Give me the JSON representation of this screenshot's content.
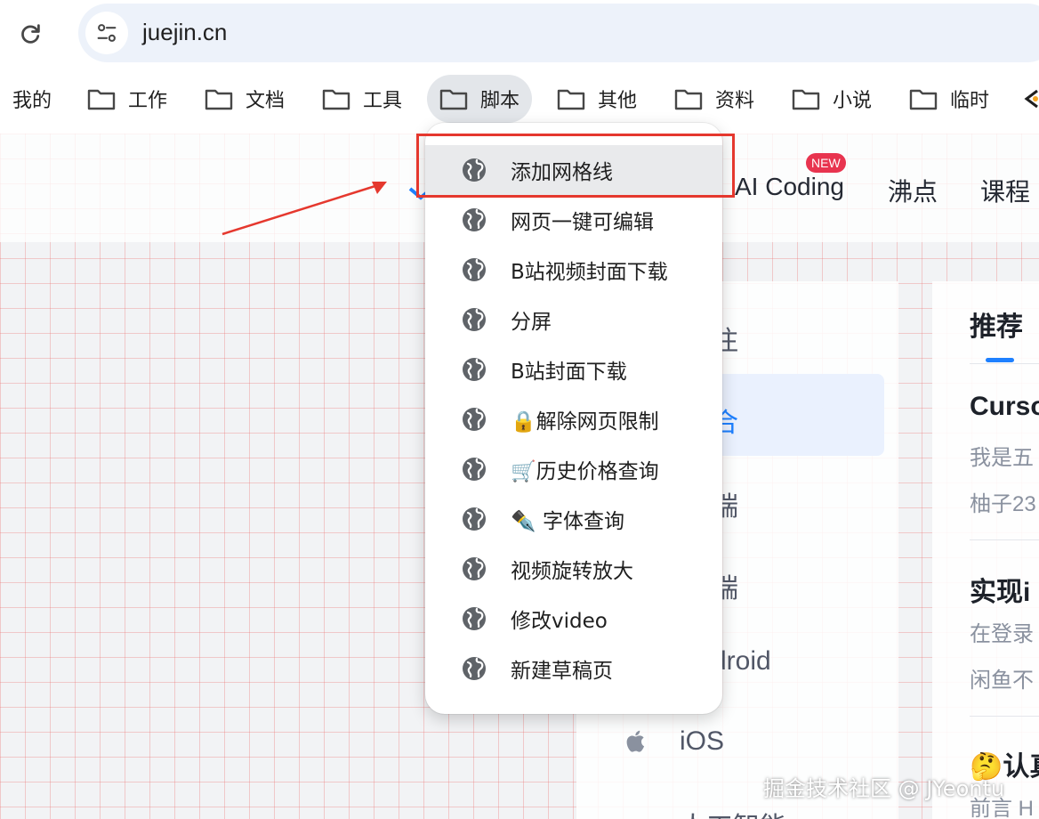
{
  "browser": {
    "url": "juejin.cn",
    "bookmarks": [
      {
        "label": "我的",
        "folder": false
      },
      {
        "label": "工作",
        "folder": true
      },
      {
        "label": "文档",
        "folder": true
      },
      {
        "label": "工具",
        "folder": true
      },
      {
        "label": "脚本",
        "folder": true,
        "active": true
      },
      {
        "label": "其他",
        "folder": true
      },
      {
        "label": "资料",
        "folder": true
      },
      {
        "label": "小说",
        "folder": true
      },
      {
        "label": "临时",
        "folder": true
      }
    ]
  },
  "site": {
    "nav": {
      "ai_coding": "AI Coding",
      "new_badge": "NEW",
      "feiDian": "沸点",
      "course": "课程"
    },
    "categories": {
      "partial_1": "注",
      "partial_2": "合",
      "partial_3": "端",
      "partial_4": "端",
      "partial_5": "droid",
      "ios": "iOS",
      "partial_7": "人工智能"
    },
    "feed": {
      "tab_recommend": "推荐",
      "items": [
        {
          "title": "Curso",
          "summary": "我是五",
          "author": "柚子23"
        },
        {
          "title": "实现i",
          "summary": "在登录",
          "author": "闲鱼不"
        },
        {
          "title": "🤔认真",
          "summary": "前言 H"
        }
      ]
    },
    "watermark": "掘金技术社区 @ JYeontu"
  },
  "menu": {
    "items": [
      {
        "label": "添加网格线",
        "hover": true
      },
      {
        "label": "网页一键可编辑"
      },
      {
        "label": "B站视频封面下载"
      },
      {
        "label": "分屏"
      },
      {
        "label": "B站封面下载"
      },
      {
        "label": "🔒解除网页限制"
      },
      {
        "label": "🛒历史价格查询"
      },
      {
        "label": "✒️ 字体查询"
      },
      {
        "label": "视频旋转放大"
      },
      {
        "label": "修改video"
      },
      {
        "label": "新建草稿页"
      }
    ]
  },
  "colors": {
    "highlight": "#e5382e",
    "grid": "#ec7878",
    "brand_blue": "#1e80ff"
  }
}
